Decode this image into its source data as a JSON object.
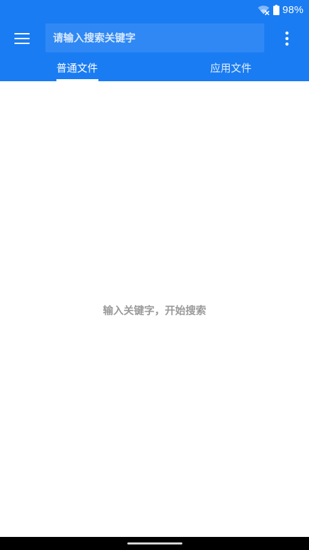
{
  "status_bar": {
    "battery": "98%",
    "icons": [
      "wifi-off-icon",
      "battery-icon"
    ]
  },
  "toolbar": {
    "menu_icon": "hamburger-menu-icon",
    "search_placeholder": "请输入搜索关键字",
    "search_value": "",
    "more_icon": "more-vert-icon"
  },
  "tabs": [
    {
      "label": "普通文件",
      "selected": true
    },
    {
      "label": "应用文件",
      "selected": false
    }
  ],
  "content": {
    "empty_hint": "输入关键字，开始搜索"
  },
  "colors": {
    "primary": "#1a7cf2",
    "search_field": "#2f88f4",
    "hint_text": "#9a9a9a",
    "background": "#ffffff",
    "nav_bar": "#000000"
  }
}
